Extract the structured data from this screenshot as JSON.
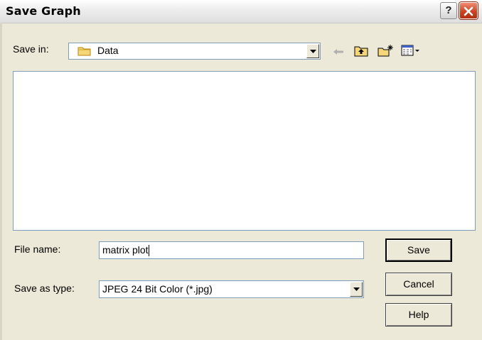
{
  "window": {
    "title": "Save Graph",
    "help_glyph": "?",
    "close_icon": "close-icon"
  },
  "toolbar": {
    "save_in_label": "Save in:",
    "save_in_value": "Data",
    "icons": [
      "back-arrow-icon",
      "up-folder-icon",
      "new-folder-icon",
      "view-menu-icon"
    ]
  },
  "form": {
    "file_name_label": "File name:",
    "file_name_value": "matrix plot",
    "save_as_type_label": "Save as type:",
    "save_as_type_value": "JPEG 24 Bit Color (*.jpg)"
  },
  "buttons": {
    "save": "Save",
    "cancel": "Cancel",
    "help": "Help"
  },
  "colors": {
    "dialog_bg": "#ece9d8",
    "border": "#7f9db9",
    "close_red": "#c9401e"
  }
}
